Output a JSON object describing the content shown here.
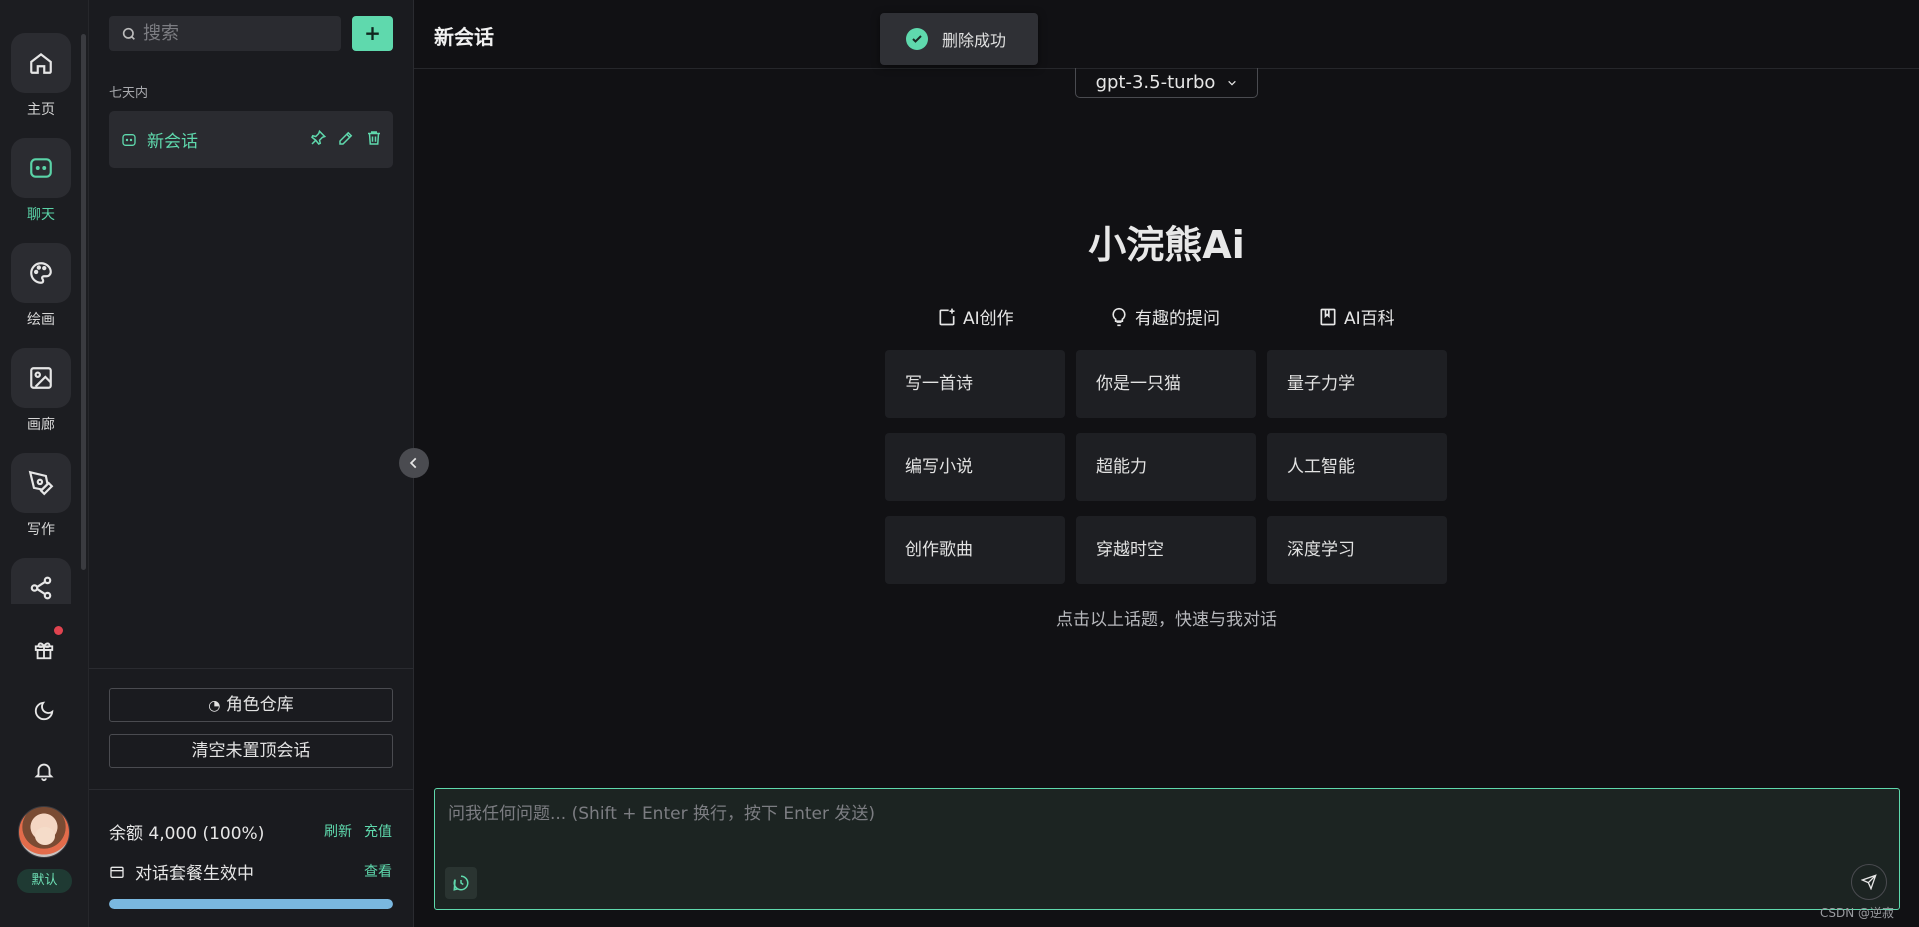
{
  "rail": {
    "items": [
      {
        "label": "主页",
        "icon": "home-icon"
      },
      {
        "label": "聊天",
        "icon": "chat-icon"
      },
      {
        "label": "绘画",
        "icon": "palette-icon"
      },
      {
        "label": "画廊",
        "icon": "image-icon"
      },
      {
        "label": "写作",
        "icon": "pen-icon"
      },
      {
        "label": "",
        "icon": "share-icon"
      }
    ],
    "active_color": "#5ad3a7",
    "default_badge": "默认"
  },
  "sidebar": {
    "search_placeholder": "搜索",
    "add_label": "+",
    "group_title": "七天内",
    "conversation_title": "新会话",
    "role_library": "角色仓库",
    "clear_unpinned": "清空未置顶会话",
    "balance": "余额 4,000 (100%)",
    "refresh": "刷新",
    "recharge": "充值",
    "plan": "对话套餐生效中",
    "view": "查看",
    "progress_fraction": 1.0
  },
  "main": {
    "title": "新会话",
    "toast": "删除成功",
    "model": "gpt-3.5-turbo",
    "brand": "小浣熊Ai",
    "categories": [
      "AI创作",
      "有趣的提问",
      "AI百科"
    ],
    "cards": [
      [
        "写一首诗",
        "你是一只猫",
        "量子力学"
      ],
      [
        "编写小说",
        "超能力",
        "人工智能"
      ],
      [
        "创作歌曲",
        "穿越时空",
        "深度学习"
      ]
    ],
    "hint": "点击以上话题，快速与我对话",
    "input_placeholder": "问我任何问题... (Shift + Enter 换行，按下 Enter 发送)",
    "watermark": "CSDN @逆寂"
  },
  "colors": {
    "accent": "#5fd9ad",
    "background": "#111114",
    "panel": "#1a1b1f"
  }
}
